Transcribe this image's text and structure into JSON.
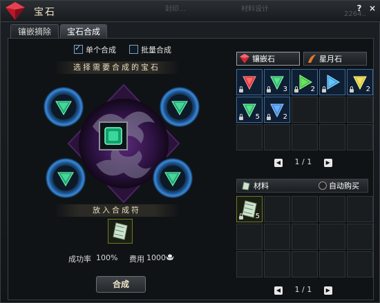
{
  "window": {
    "title": "宝石",
    "help_label": "?",
    "close_label": "×",
    "ghost_1": "封印...",
    "ghost_2": "材料设计",
    "ghost_3": "2264.."
  },
  "tabs": [
    {
      "label": "镶嵌摘除",
      "active": false
    },
    {
      "label": "宝石合成",
      "active": true
    }
  ],
  "left": {
    "single_label": "单个合成",
    "single_checked": true,
    "batch_label": "批量合成",
    "batch_checked": false,
    "select_heading": "选择需要合成的宝石",
    "charm_heading": "放入合成符",
    "success_label": "成功率",
    "success_value": "100%",
    "cost_label": "费用",
    "cost_value": "1000",
    "combine_button": "合成",
    "slots": [
      "emerald-gem",
      "emerald-gem",
      "emerald-gem",
      "emerald-gem"
    ],
    "center_gem": "emerald-square-gem"
  },
  "right": {
    "tab_inlay": "镶嵌石",
    "tab_moon": "星月石",
    "gems": [
      {
        "color": "#e0393b",
        "count": "",
        "locked": true
      },
      {
        "color": "#2fb866",
        "count": "3",
        "locked": true
      },
      {
        "color": "#3fc23a",
        "count": "2",
        "locked": true
      },
      {
        "color": "#39a6e8",
        "count": "",
        "locked": true
      },
      {
        "color": "#d9c93a",
        "count": "2",
        "locked": true
      },
      {
        "color": "#2fb866",
        "count": "5",
        "locked": true
      },
      {
        "color": "#3f8fe6",
        "count": "2",
        "locked": true
      }
    ],
    "gem_page": "1 / 1",
    "materials_label": "材料",
    "auto_buy_label": "自动购买",
    "materials": [
      {
        "item": "charm-scroll",
        "count": "5",
        "locked": true
      }
    ],
    "material_page": "1 / 1"
  }
}
